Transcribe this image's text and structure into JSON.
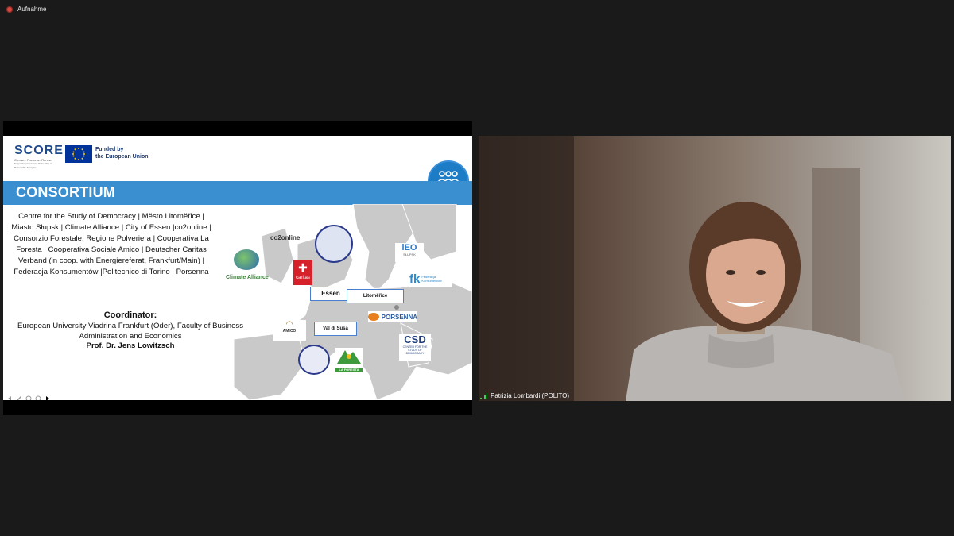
{
  "recording": {
    "label": "Aufnahme",
    "icon": "recording-dot-icon",
    "color": "#d9463b"
  },
  "slide": {
    "logo": {
      "brand": "SCORE",
      "tagline": "Co-own. Prosume. Renew",
      "subtagline": "Supporting Consumer Ownership in Renewable Energies"
    },
    "eu": {
      "line1": "Funded by",
      "line2": "the European Union"
    },
    "banner_title": "CONSORTIUM",
    "members_text": "Centre for the Study of Democracy | Město Litoměřice | Miasto Słupsk | Climate Alliance | City of Essen |co2online | Consorzio Forestale, Regione Polveriera | Cooperativa La Foresta | Cooperativa Sociale Amico | Deutscher Caritas Verband (in coop. with Energiereferat, Frankfurt/Main) | Federacja Konsumentów |Politecnico di Torino | Porsenna",
    "coordinator_label": "Coordinator",
    "coordinator_colon": ":",
    "coordinator_org": "European University Viadrina Frankfurt (Oder), Faculty of Business Administration and Economics",
    "coordinator_name": "Prof. Dr. Jens Lowitzsch",
    "map_logos": {
      "co2online": "co2online",
      "climate_alliance": "Climate Alliance",
      "caritas": "caritas",
      "ieo": "iEO",
      "ieo_sub": "SŁUPSK",
      "fk": "fk",
      "fk_sub": "Federacja Konsumentów",
      "porsenna": "PORSENNA",
      "csd": "CSD",
      "csd_sub": "CENTER FOR THE STUDY OF DEMOCRACY",
      "amico": "AMICO",
      "laforesta": "LA FORESTA"
    },
    "cities": {
      "essen": "Essen",
      "litomerice": "Litoměřice",
      "val_di_susa": "Val di Susa"
    }
  },
  "video": {
    "participant_name": "Patrizia  Lombardi (POLITO)",
    "signal_icon": "signal-bars-icon"
  },
  "colors": {
    "background": "#1a1a1a",
    "banner": "#3a8fd0",
    "eu_blue": "#003399",
    "signal_green": "#3bd15e"
  }
}
